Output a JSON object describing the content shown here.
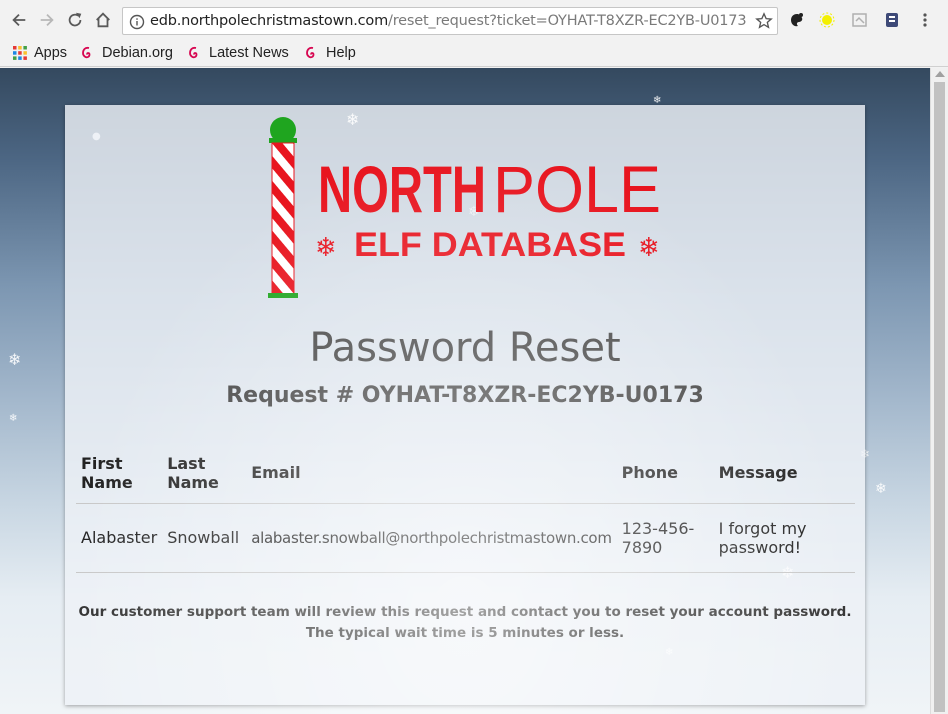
{
  "browser": {
    "url_host": "edb.northpolechristmastown.com",
    "url_path": "/reset_request?ticket=OYHAT-T8XZR-EC2YB-U0173",
    "bookmarks": [
      {
        "label": "Apps",
        "icon": "apps-grid-icon"
      },
      {
        "label": "Debian.org",
        "icon": "debian-swirl-icon"
      },
      {
        "label": "Latest News",
        "icon": "debian-swirl-icon"
      },
      {
        "label": "Help",
        "icon": "debian-swirl-icon"
      }
    ]
  },
  "logo": {
    "line1_bold": "NORTH",
    "line1_light": "POLE",
    "line2": "ELF DATABASE",
    "colors": {
      "red": "#e8151f",
      "green": "#1fa51f"
    }
  },
  "page": {
    "title": "Password Reset",
    "request_label": "Request # OYHAT-T8XZR-EC2YB-U0173"
  },
  "table": {
    "headers": [
      "First Name",
      "Last Name",
      "Email",
      "Phone",
      "Message"
    ],
    "rows": [
      [
        "Alabaster",
        "Snowball",
        "alabaster.snowball@northpolechristmastown.com",
        "123-456-7890",
        "I forgot my password!"
      ]
    ]
  },
  "note": {
    "line1": "Our customer support team will review this request and contact you to reset your account password.",
    "line2": "The typical wait time is 5 minutes or less."
  }
}
